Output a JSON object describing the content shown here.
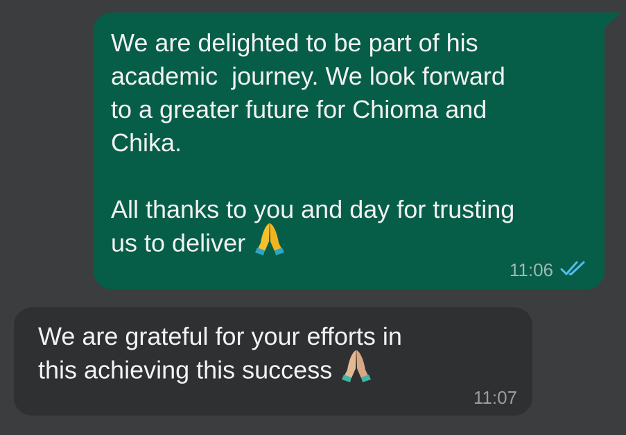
{
  "messages": [
    {
      "direction": "outgoing",
      "text_part1": "We are delighted to be part of his\nacademic  journey. We look forward\nto a greater future for Chioma and\nChika.\n\nAll thanks to you and day for trusting\nus to deliver",
      "emoji": "folded-hands-icon",
      "time": "11:06",
      "status": "double-check-read-icon"
    },
    {
      "direction": "incoming",
      "text_part1": "We are grateful for your efforts in\nthis achieving this success",
      "emoji": "folded-hands-icon",
      "time": "11:07"
    }
  ],
  "colors": {
    "background": "#3b3d3e",
    "outgoing_bubble": "#075e48",
    "incoming_bubble": "#2e3031",
    "read_tick": "#53bdeb"
  }
}
